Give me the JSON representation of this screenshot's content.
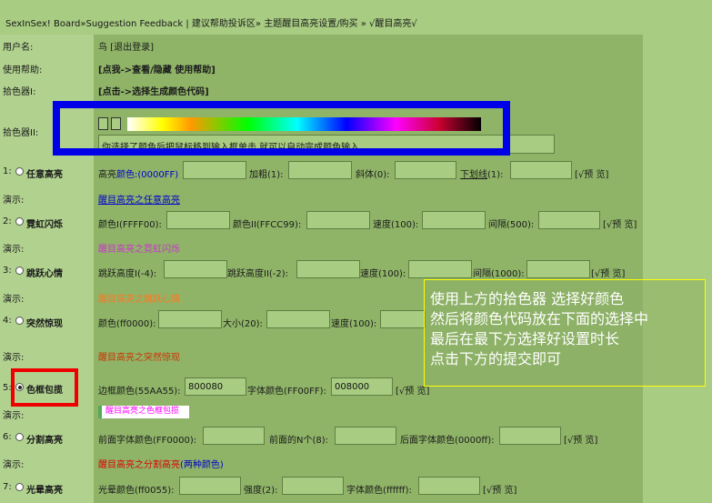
{
  "breadcrumb": "SexInSex! Board»Suggestion Feedback | 建议帮助投诉区» 主题醒目高亮设置/购买 » √醒目高亮√",
  "username_label": "用户名:",
  "username_value": "鸟 [退出登录]",
  "help_label": "使用帮助:",
  "help_value": "[点我->查看/隐藏 使用帮助]",
  "picker1_label": "拾色器I:",
  "picker1_value": "[点击->选择生成颜色代码]",
  "picker2_label": "拾色器II:",
  "picker_hint": "你选择了颜色后把鼠标移到输入框单击,就可以自动完成颜色输入",
  "demo_label": "演示:",
  "preview_label": "[√预 览]",
  "options": {
    "o1": {
      "label": "1:",
      "name": "任意高亮",
      "color_label": "高亮",
      "color_label_hl": "颜色:(0000FF)",
      "bold_label": "加粗(1):",
      "italic_label": "斜体(0):",
      "underline_label": "下划线",
      "underline_suffix": "(1):",
      "demo": "醒目高亮之任意高亮"
    },
    "o2": {
      "label": "2:",
      "name": "霓虹闪烁",
      "c1_label": "颜色I(FFFF00):",
      "c2_label": "颜色II(FFCC99):",
      "speed_label": "速度(100):",
      "interval_label": "间隔(500):",
      "demo": "醒目高亮之霓虹闪烁"
    },
    "o3": {
      "label": "3:",
      "name": "跳跃心情",
      "h1_label": "跳跃高度I(-4):",
      "h2_label": "跳跃高度II(-2):",
      "speed_label": "速度(100):",
      "interval_label": "间隔(1000):",
      "demo": "醒目高亮之跳跃心情"
    },
    "o4": {
      "label": "4:",
      "name": "突然惊现",
      "color_label": "颜色(ff0000):",
      "size_label": "大小(20):",
      "speed_label": "速度(100):",
      "demo": "醒目高亮之突然惊现"
    },
    "o5": {
      "label": "5:",
      "name": "色框包揽",
      "border_label": "边框颜色(55AA55):",
      "border_value": "800080",
      "font_label": "字体颜色(FF00FF):",
      "font_value": "008000",
      "demo": "醒目高亮之色框包揽"
    },
    "o6": {
      "label": "6:",
      "name": "分割高亮",
      "front_label": "前面字体颜色(FF0000):",
      "n_label": "前面的N个(8):",
      "back_label": "后面字体颜色(0000ff):",
      "demo_a": "醒目高亮之分割高亮",
      "demo_b": "(两种颜色)"
    },
    "o7": {
      "label": "7:",
      "name": "光晕高亮",
      "glow_label": "光晕颜色(ff0055):",
      "strength_label": "强度(2):",
      "font_label": "字体颜色(ffffff):"
    }
  },
  "tooltip": [
    "使用上方的拾色器 选择好颜色",
    "然后将颜色代码放在下面的选择中",
    "最后在最下方选择好设置时长",
    "点击下方的提交即可"
  ],
  "colors": {
    "background": "#98be72",
    "label_column": "#b1d18f",
    "main_column": "#8fb468",
    "highlight_frame": "#0000e8",
    "selection_frame": "#ee0000",
    "tooltip_border": "#ffff00"
  }
}
